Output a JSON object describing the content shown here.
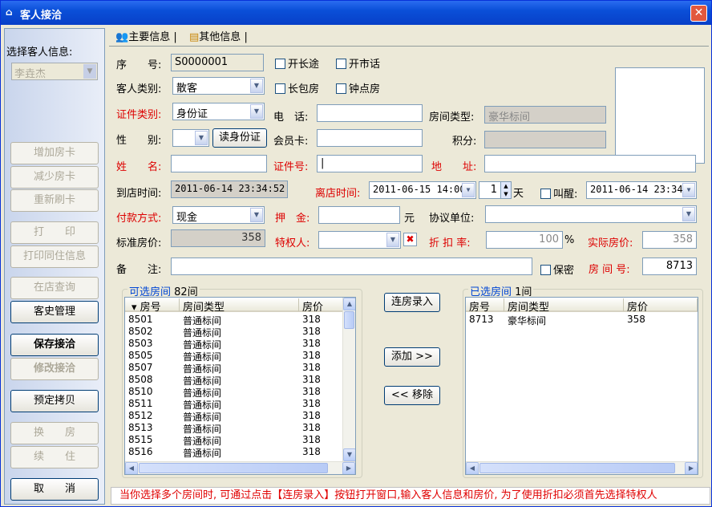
{
  "window": {
    "title": "客人接洽",
    "close_label": "✕"
  },
  "sidebar": {
    "select_label": "选择客人信息:",
    "select_value": "李垚杰",
    "buttons": [
      "增加房卡",
      "减少房卡",
      "重新刷卡",
      "打　　印",
      "打印同住信息",
      "在店查询",
      "客史管理",
      "保存接洽",
      "修改接洽",
      "预定拷贝",
      "换　　房",
      "续　　住",
      "取　　消"
    ]
  },
  "tabs": {
    "main": "主要信息",
    "other": "其他信息"
  },
  "form": {
    "serial_label": "序　　号:",
    "serial_value": "S0000001",
    "long_trip": "开长途",
    "city_call": "开市话",
    "long_stay": "长包房",
    "hourly_room": "钟点房",
    "guest_type_label": "客人类别:",
    "guest_type_value": "散客",
    "id_type_label": "证件类别:",
    "id_type_value": "身份证",
    "phone_label": "电　话:",
    "phone_value": "",
    "room_type_label": "房间类型:",
    "room_type_value": "豪华标间",
    "gender_label": "性　　别:",
    "gender_value": "",
    "read_id_btn": "读身份证",
    "member_card_label": "会员卡:",
    "points_label": "积分:",
    "name_label": "姓　　名:",
    "id_no_label": "证件号:",
    "address_label": "地　　址:",
    "arrive_label": "到店时间:",
    "arrive_value": "2011-06-14 23:34:52",
    "leave_label": "离店时间:",
    "leave_value": "2011-06-15 14:00",
    "days_value": "1",
    "days_unit": "天",
    "wakeup_label": "叫醒:",
    "wakeup_value": "2011-06-14 23:34",
    "pay_label": "付款方式:",
    "pay_value": "现金",
    "deposit_label": "押　金:",
    "deposit_unit": "元",
    "agreement_label": "协议单位:",
    "std_price_label": "标准房价:",
    "std_price_value": "358",
    "privileged_label": "特权人:",
    "discount_label": "折 扣 率:",
    "discount_value": "100",
    "discount_unit": "%",
    "actual_price_label": "实际房价:",
    "actual_price_value": "358",
    "remark_label": "备　　注:",
    "secret_label": "保密",
    "room_no_label": "房 间 号:",
    "room_no_value": "8713"
  },
  "available": {
    "title": "可选房间",
    "count": "82间",
    "headers": [
      "房号",
      "房间类型",
      "房价"
    ],
    "rows": [
      [
        "8501",
        "普通标间",
        "318"
      ],
      [
        "8502",
        "普通标间",
        "318"
      ],
      [
        "8503",
        "普通标间",
        "318"
      ],
      [
        "8505",
        "普通标间",
        "318"
      ],
      [
        "8507",
        "普通标间",
        "318"
      ],
      [
        "8508",
        "普通标间",
        "318"
      ],
      [
        "8510",
        "普通标间",
        "318"
      ],
      [
        "8511",
        "普通标间",
        "318"
      ],
      [
        "8512",
        "普通标间",
        "318"
      ],
      [
        "8513",
        "普通标间",
        "318"
      ],
      [
        "8515",
        "普通标间",
        "318"
      ],
      [
        "8516",
        "普通标间",
        "318"
      ]
    ]
  },
  "selected": {
    "title": "已选房间",
    "count": "1间",
    "headers": [
      "房号",
      "房间类型",
      "房价"
    ],
    "rows": [
      [
        "8713",
        "豪华标间",
        "358"
      ]
    ]
  },
  "actions": {
    "multi_entry": "连房录入",
    "add": "添加 >>",
    "remove": "<< 移除"
  },
  "hint": "当你选择多个房间时, 可通过点击【连房录入】按钮打开窗口,输入客人信息和房价, 为了使用折扣必须首先选择特权人",
  "colors": {
    "title_blue": "#0a4fd8",
    "label_red": "#dd0000",
    "window_bg": "#ece9d8"
  }
}
